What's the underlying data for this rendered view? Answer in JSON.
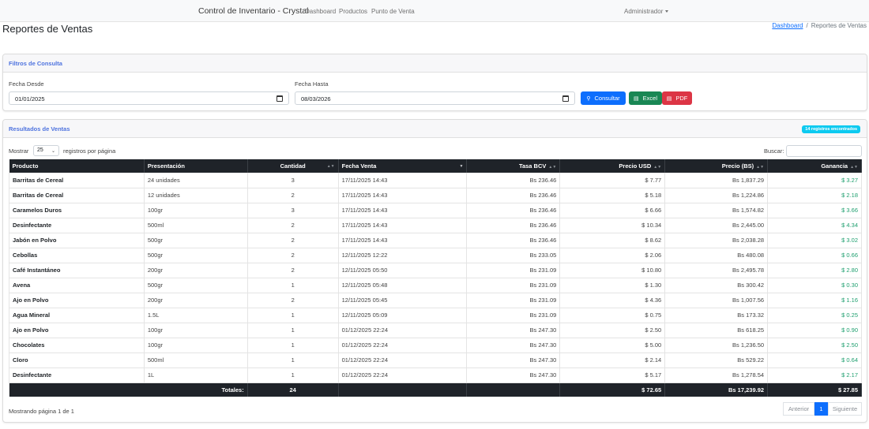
{
  "navbar": {
    "brand": "Control de Inventario - Crystal",
    "links": [
      "Dashboard",
      "Productos",
      "Punto de Venta"
    ],
    "user": "Administrador"
  },
  "header": {
    "title": "Reportes de Ventas",
    "breadcrumb_link": "Dashboard",
    "breadcrumb_sep": "/",
    "breadcrumb_current": "Reportes de Ventas"
  },
  "filters": {
    "title": "Filtros de Consulta",
    "from_label": "Fecha Desde",
    "from_value": "01/01/2025",
    "to_label": "Fecha Hasta",
    "to_value": "08/03/2026",
    "consult_label": "Consultar",
    "excel_label": "Excel",
    "pdf_label": "PDF"
  },
  "results": {
    "title": "Resultados de Ventas",
    "badge": "14 registros encontrados",
    "show_label": "Mostrar",
    "page_size": "25",
    "per_page_label": "registros por página",
    "search_label": "Buscar:",
    "columns": [
      "Producto",
      "Presentación",
      "Cantidad",
      "Fecha Venta",
      "Tasa BCV",
      "Precio USD",
      "Precio (BS)",
      "Ganancia"
    ],
    "rows": [
      [
        "Barritas de Cereal",
        "24 unidades",
        "3",
        "17/11/2025 14:43",
        "Bs 236.46",
        "$ 7.77",
        "Bs 1,837.29",
        "$ 3.27"
      ],
      [
        "Barritas de Cereal",
        "12 unidades",
        "2",
        "17/11/2025 14:43",
        "Bs 236.46",
        "$ 5.18",
        "Bs 1,224.86",
        "$ 2.18"
      ],
      [
        "Caramelos Duros",
        "100gr",
        "3",
        "17/11/2025 14:43",
        "Bs 236.46",
        "$ 6.66",
        "Bs 1,574.82",
        "$ 3.66"
      ],
      [
        "Desinfectante",
        "500ml",
        "2",
        "17/11/2025 14:43",
        "Bs 236.46",
        "$ 10.34",
        "Bs 2,445.00",
        "$ 4.34"
      ],
      [
        "Jabón en Polvo",
        "500gr",
        "2",
        "17/11/2025 14:43",
        "Bs 236.46",
        "$ 8.62",
        "Bs 2,038.28",
        "$ 3.02"
      ],
      [
        "Cebollas",
        "500gr",
        "2",
        "12/11/2025 12:22",
        "Bs 233.05",
        "$ 2.06",
        "Bs 480.08",
        "$ 0.66"
      ],
      [
        "Café Instantáneo",
        "200gr",
        "2",
        "12/11/2025 05:50",
        "Bs 231.09",
        "$ 10.80",
        "Bs 2,495.78",
        "$ 2.80"
      ],
      [
        "Avena",
        "500gr",
        "1",
        "12/11/2025 05:48",
        "Bs 231.09",
        "$ 1.30",
        "Bs 300.42",
        "$ 0.30"
      ],
      [
        "Ajo en Polvo",
        "200gr",
        "2",
        "12/11/2025 05:45",
        "Bs 231.09",
        "$ 4.36",
        "Bs 1,007.56",
        "$ 1.16"
      ],
      [
        "Agua Mineral",
        "1.5L",
        "1",
        "12/11/2025 05:09",
        "Bs 231.09",
        "$ 0.75",
        "Bs 173.32",
        "$ 0.25"
      ],
      [
        "Ajo en Polvo",
        "100gr",
        "1",
        "01/12/2025 22:24",
        "Bs 247.30",
        "$ 2.50",
        "Bs 618.25",
        "$ 0.90"
      ],
      [
        "Chocolates",
        "100gr",
        "1",
        "01/12/2025 22:24",
        "Bs 247.30",
        "$ 5.00",
        "Bs 1,236.50",
        "$ 2.50"
      ],
      [
        "Cloro",
        "500ml",
        "1",
        "01/12/2025 22:24",
        "Bs 247.30",
        "$ 2.14",
        "Bs 529.22",
        "$ 0.64"
      ],
      [
        "Desinfectante",
        "1L",
        "1",
        "01/12/2025 22:24",
        "Bs 247.30",
        "$ 5.17",
        "Bs 1,278.54",
        "$ 2.17"
      ]
    ],
    "totals_label": "Totales:",
    "total_qty": "24",
    "total_usd": "$ 72.65",
    "total_bs": "Bs 17,239.92",
    "total_profit": "$ 27.85",
    "page_info": "Mostrando página 1 de 1",
    "prev_label": "Anterior",
    "current_page": "1",
    "next_label": "Siguiente"
  }
}
